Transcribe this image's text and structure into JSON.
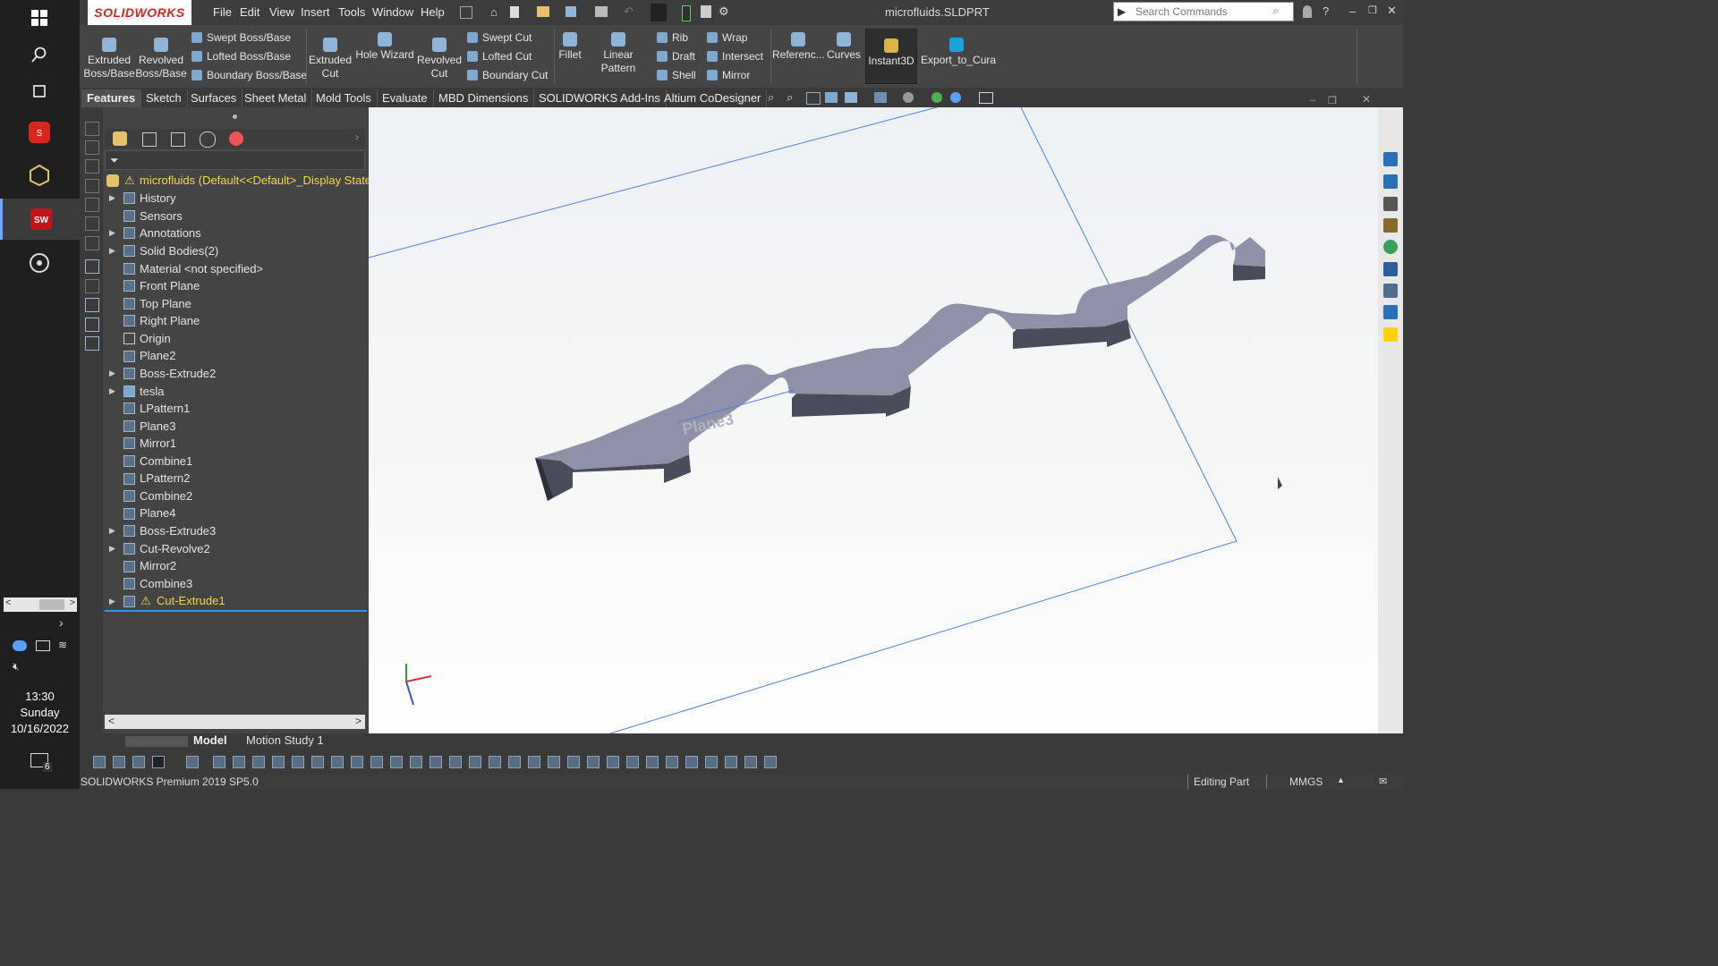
{
  "app": {
    "logo": "SOLIDWORKS",
    "title": "microfluids.SLDPRT",
    "search_placeholder": "Search Commands"
  },
  "menu": [
    "File",
    "Edit",
    "View",
    "Insert",
    "Tools",
    "Window",
    "Help"
  ],
  "ribbon": {
    "extruded_boss": "Extruded Boss/Base",
    "revolved_boss": "Revolved Boss/Base",
    "swept_boss": "Swept Boss/Base",
    "lofted_boss": "Lofted Boss/Base",
    "boundary_boss": "Boundary Boss/Base",
    "extruded_cut": "Extruded Cut",
    "hole_wizard": "Hole Wizard",
    "revolved_cut": "Revolved Cut",
    "swept_cut": "Swept Cut",
    "lofted_cut": "Lofted Cut",
    "boundary_cut": "Boundary Cut",
    "fillet": "Fillet",
    "linear_pattern": "Linear Pattern",
    "rib": "Rib",
    "draft": "Draft",
    "shell": "Shell",
    "wrap": "Wrap",
    "intersect": "Intersect",
    "mirror": "Mirror",
    "reference": "Referenc...",
    "curves": "Curves",
    "instant3d": "Instant3D",
    "export_cura": "Export_to_Cura"
  },
  "tabs": [
    "Features",
    "Sketch",
    "Surfaces",
    "Sheet Metal",
    "Mold Tools",
    "Evaluate",
    "MBD Dimensions",
    "SOLIDWORKS Add-Ins",
    "Altium CoDesigner"
  ],
  "tree": {
    "root": "microfluids  (Default<<Default>_Display State",
    "items": [
      "History",
      "Sensors",
      "Annotations",
      "Solid Bodies(2)",
      "Material <not specified>",
      "Front Plane",
      "Top Plane",
      "Right Plane",
      "Origin",
      "Plane2",
      "Boss-Extrude2",
      "tesla",
      "LPattern1",
      "Plane3",
      "Mirror1",
      "Combine1",
      "LPattern2",
      "Combine2",
      "Plane4",
      "Boss-Extrude3",
      "Cut-Revolve2",
      "Mirror2",
      "Combine3",
      "Cut-Extrude1"
    ]
  },
  "viewport": {
    "plane_label": "Plane3"
  },
  "bottom_tabs": {
    "model": "Model",
    "motion": "Motion Study 1"
  },
  "status": {
    "version": "SOLIDWORKS Premium 2019 SP5.0",
    "mode": "Editing Part",
    "units": "MMGS"
  },
  "clock": {
    "time": "13:30",
    "day": "Sunday",
    "date": "10/16/2022"
  },
  "notifications": "6"
}
